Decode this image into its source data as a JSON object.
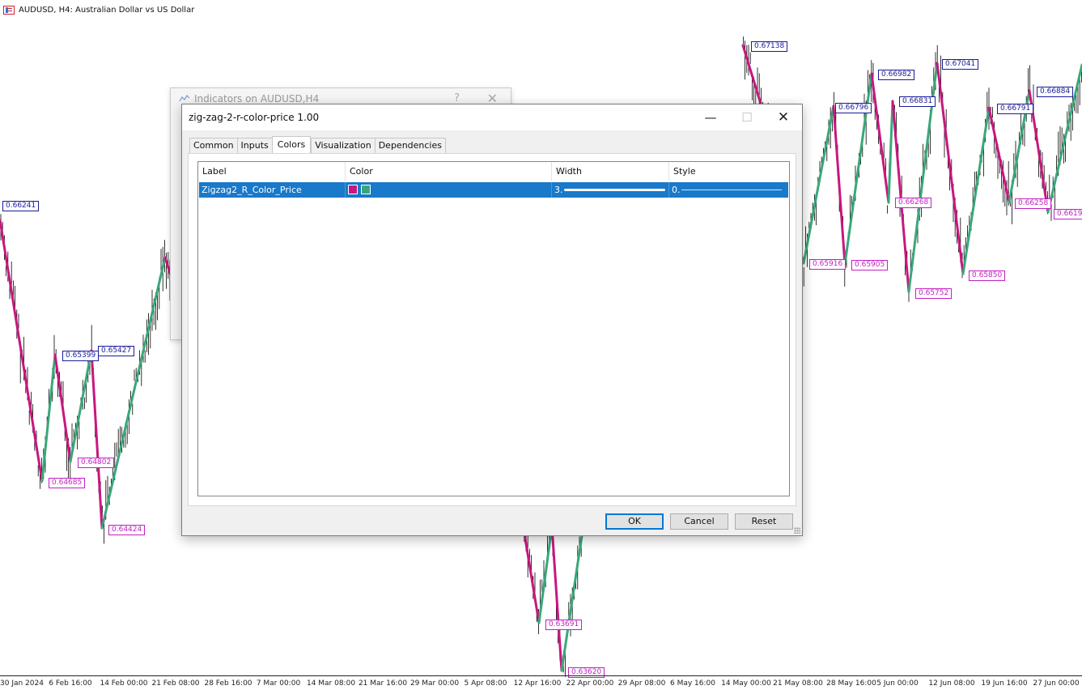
{
  "chart": {
    "title": "AUDUSD, H4:  Australian Dollar vs US Dollar",
    "title_icon": "chart-window-icon",
    "colors": {
      "down_segment": "#c8177f",
      "up_segment": "#3aa77a",
      "bars": "#000000",
      "high_label": "#1a1a9a",
      "low_label": "#c21fc2"
    },
    "price_labels": [
      {
        "text": "0.66241",
        "kind": "high"
      },
      {
        "text": "0.64685",
        "kind": "low"
      },
      {
        "text": "0.65399",
        "kind": "high"
      },
      {
        "text": "0.64802",
        "kind": "low"
      },
      {
        "text": "0.65427",
        "kind": "high"
      },
      {
        "text": "0.64424",
        "kind": "low"
      },
      {
        "text": "0.63691",
        "kind": "low"
      },
      {
        "text": "0.63620",
        "kind": "low"
      },
      {
        "text": "0.67138",
        "kind": "high"
      },
      {
        "text": "0.65916",
        "kind": "low"
      },
      {
        "text": "0.66796",
        "kind": "high"
      },
      {
        "text": "0.65905",
        "kind": "low"
      },
      {
        "text": "0.66982",
        "kind": "high"
      },
      {
        "text": "0.66268",
        "kind": "low"
      },
      {
        "text": "0.66831",
        "kind": "high"
      },
      {
        "text": "0.65752",
        "kind": "low"
      },
      {
        "text": "0.67041",
        "kind": "high"
      },
      {
        "text": "0.65850",
        "kind": "low"
      },
      {
        "text": "0.66791",
        "kind": "high"
      },
      {
        "text": "0.66258",
        "kind": "low"
      },
      {
        "text": "0.66884",
        "kind": "high"
      },
      {
        "text": "0.66197",
        "kind": "low"
      }
    ],
    "time_axis": [
      "30 Jan 2024",
      "6 Feb 16:00",
      "14 Feb 00:00",
      "21 Feb 08:00",
      "28 Feb 16:00",
      "7 Mar 00:00",
      "14 Mar 08:00",
      "21 Mar 16:00",
      "29 Mar 00:00",
      "5 Apr 08:00",
      "12 Apr 16:00",
      "22 Apr 00:00",
      "29 Apr 08:00",
      "6 May 16:00",
      "14 May 00:00",
      "21 May 08:00",
      "28 May 16:00",
      "5 Jun 00:00",
      "12 Jun 08:00",
      "19 Jun 16:00",
      "27 Jun 00:00"
    ]
  },
  "background_dialog": {
    "title": "Indicators on AUDUSD,H4",
    "help": "?",
    "close": "✕"
  },
  "dialog": {
    "title": "zig-zag-2-r-color-price 1.00",
    "minimize": "—",
    "maximize": "☐",
    "close": "✕",
    "tabs": [
      {
        "label": "Common",
        "active": false
      },
      {
        "label": "Inputs",
        "active": false
      },
      {
        "label": "Colors",
        "active": true
      },
      {
        "label": "Visualization",
        "active": false
      },
      {
        "label": "Dependencies",
        "active": false
      }
    ],
    "table": {
      "columns": [
        "Label",
        "Color",
        "Width",
        "Style"
      ],
      "rows": [
        {
          "label": "Zigzag2_R_Color_Price",
          "colors": [
            "#c8177f",
            "#3aa77a"
          ],
          "width": "3.",
          "style": "0."
        }
      ]
    },
    "buttons": {
      "ok": "OK",
      "cancel": "Cancel",
      "reset": "Reset"
    }
  }
}
